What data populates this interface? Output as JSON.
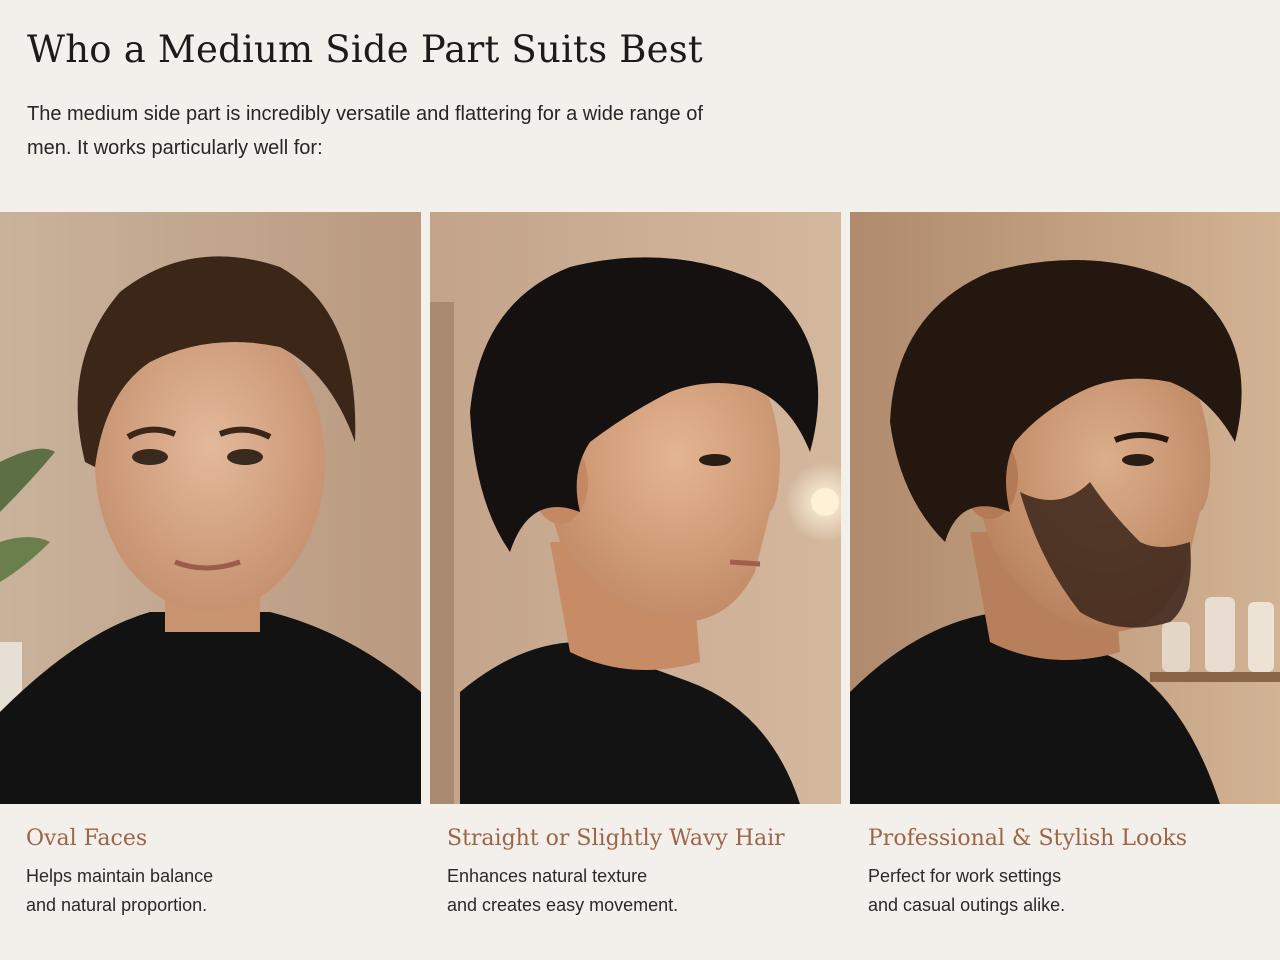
{
  "header": {
    "title": "Who a Medium Side Part Suits Best",
    "intro": "The medium side part is incredibly versatile and flattering for a wide range of men. It works particularly well for:"
  },
  "cards": [
    {
      "title": "Oval Faces",
      "description": "Helps maintain balance\nand natural proportion.",
      "image": "man-front-portrait-photo"
    },
    {
      "title": "Straight or Slightly Wavy Hair",
      "description": "Enhances natural texture\nand creates easy movement.",
      "image": "man-side-profile-photo"
    },
    {
      "title": "Professional & Stylish Looks",
      "description": "Perfect for work settings\nand casual outings alike.",
      "image": "bearded-man-profile-photo"
    }
  ],
  "colors": {
    "background": "#f3efea",
    "accent": "#9a6548",
    "text": "#1f1f1f"
  }
}
